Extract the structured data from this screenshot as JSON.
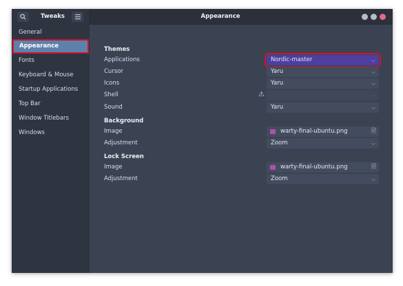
{
  "headerbar": {
    "app_title": "Tweaks",
    "page_title": "Appearance",
    "search_icon": "search-icon",
    "menu_icon": "hamburger-menu-icon"
  },
  "sidebar": {
    "items": [
      {
        "label": "General"
      },
      {
        "label": "Appearance",
        "active": true
      },
      {
        "label": "Fonts"
      },
      {
        "label": "Keyboard & Mouse"
      },
      {
        "label": "Startup Applications"
      },
      {
        "label": "Top Bar"
      },
      {
        "label": "Window Titlebars"
      },
      {
        "label": "Windows"
      }
    ]
  },
  "themes": {
    "heading": "Themes",
    "applications": {
      "label": "Applications",
      "value": "Nordic-master"
    },
    "cursor": {
      "label": "Cursor",
      "value": "Yaru"
    },
    "icons": {
      "label": "Icons",
      "value": "Yaru"
    },
    "shell": {
      "label": "Shell",
      "value": ""
    },
    "sound": {
      "label": "Sound",
      "value": "Yaru"
    }
  },
  "background": {
    "heading": "Background",
    "image": {
      "label": "Image",
      "value": "warty-final-ubuntu.png"
    },
    "adjustment": {
      "label": "Adjustment",
      "value": "Zoom"
    }
  },
  "lock_screen": {
    "heading": "Lock Screen",
    "image": {
      "label": "Image",
      "value": "warty-final-ubuntu.png"
    },
    "adjustment": {
      "label": "Adjustment",
      "value": "Zoom"
    }
  },
  "colors": {
    "window_bg": "#3b4252",
    "sidebar_bg": "#2e3440",
    "selection": "#5e81ac",
    "highlight_box": "#d0152d"
  }
}
